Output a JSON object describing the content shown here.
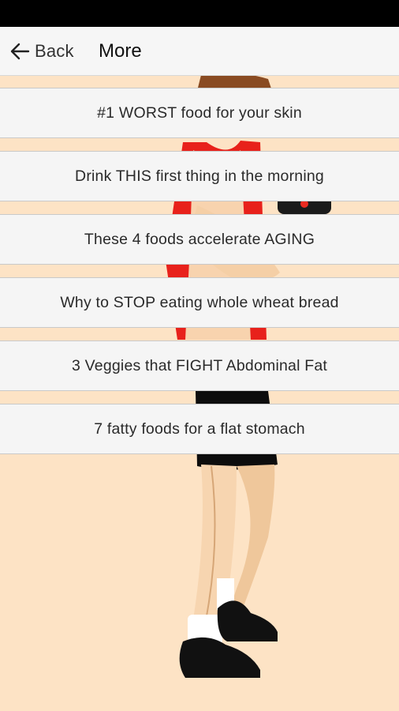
{
  "header": {
    "back_label": "Back",
    "title": "More"
  },
  "menu": {
    "items": [
      {
        "label": "#1 WORST food for your skin"
      },
      {
        "label": "Drink THIS first thing in the morning"
      },
      {
        "label": "These 4 foods accelerate AGING"
      },
      {
        "label": "Why to STOP eating whole wheat bread"
      },
      {
        "label": "3 Veggies that FIGHT Abdominal Fat"
      },
      {
        "label": "7 fatty foods for a flat stomach"
      }
    ]
  },
  "icons": {
    "back": "arrow-left-icon"
  },
  "colors": {
    "background": "#fde3c5",
    "status_bar": "#000000",
    "app_bar": "#f6f6f6",
    "menu_item": "#f5f5f5",
    "illustration_red": "#e8211b"
  }
}
